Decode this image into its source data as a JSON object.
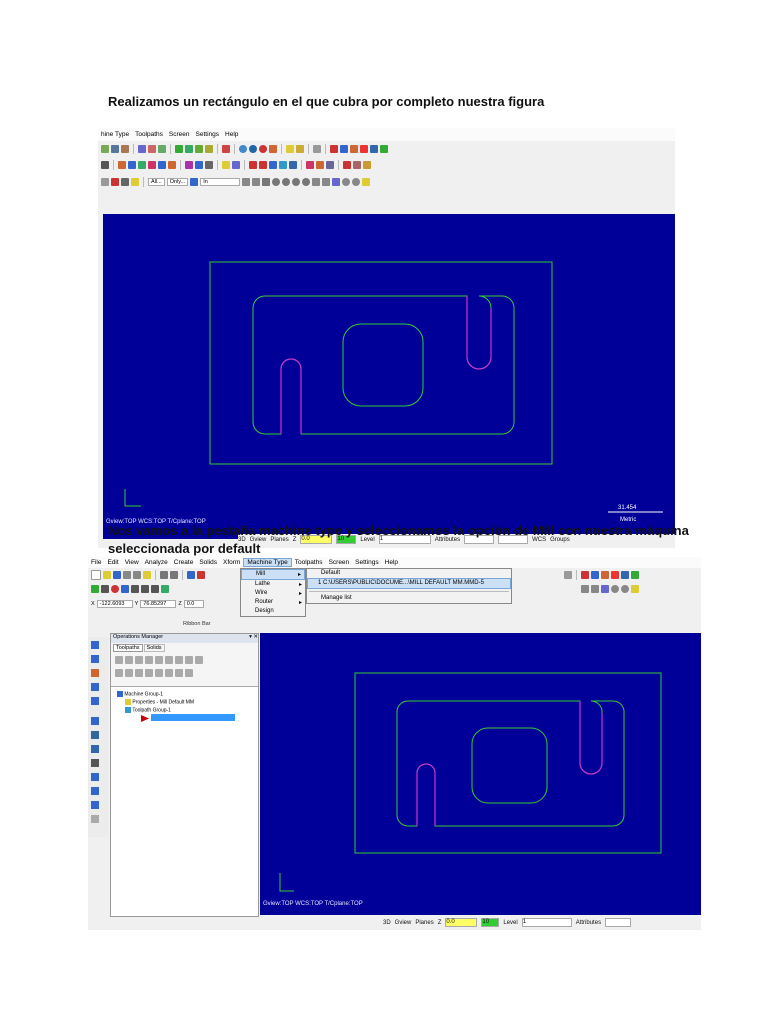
{
  "heading1": "Realizamos un rectángulo en el que cubra por completo nuestra figura",
  "heading2_line1": "Nos vamos a la pestaña machine type y seleccionamos la opción de Mill con nuestra máquina",
  "heading2_line2": "seleccionada por default",
  "shot1": {
    "menu": [
      "hine Type",
      "Toolpaths",
      "Screen",
      "Settings",
      "Help"
    ],
    "row4": {
      "all": "All...",
      "only": "Only...",
      "in": "In"
    },
    "gview": "Gview:TOP  WCS:TOP  T/Cplane:TOP",
    "scale_value": "31.454",
    "scale_unit": "Metric",
    "status": {
      "d3": "3D",
      "gview": "Gview",
      "planes": "Planes",
      "z": "Z",
      "zval": "0.0",
      "lvl": "10",
      "level": "Level",
      "levelval": "1",
      "attributes": "Attributes",
      "wcs": "WCS",
      "groups": "Groups"
    }
  },
  "shot2": {
    "menu": [
      "File",
      "Edit",
      "View",
      "Analyze",
      "Create",
      "Solids",
      "Xform",
      "Machine Type",
      "Toolpaths",
      "Screen",
      "Settings",
      "Help"
    ],
    "coords": {
      "x": "-122.6093",
      "y": "76.85297",
      "z": "0.0"
    },
    "ribbon": "Ribbon Bar",
    "machine_menu": [
      "Mill",
      "Lathe",
      "Wire",
      "Router",
      "Design"
    ],
    "submenu": [
      "Default",
      "1  C:\\USERS\\PUBLIC\\DOCUME...\\MILL DEFAULT MM.MMD-5",
      "Manage list"
    ],
    "ops": {
      "title": "Operations Manager",
      "tab1": "Toolpaths",
      "tab2": "Solids",
      "tree": [
        "Machine Group-1",
        "Properties - Mill Default MM",
        "Toolpath Group-1"
      ]
    },
    "gview": "Gview:TOP   WCS:TOP   T/Cplane:TOP",
    "status": {
      "d3": "3D",
      "gview": "Gview",
      "planes": "Planes",
      "z": "Z",
      "zval": "0.0",
      "lvl": "10",
      "level": "Level",
      "levelval": "1",
      "attributes": "Attributes"
    }
  },
  "colors": {
    "canvas": "#000099",
    "geom_green": "#33cc33",
    "geom_magenta": "#cc33cc",
    "selection": "#3399ff"
  }
}
